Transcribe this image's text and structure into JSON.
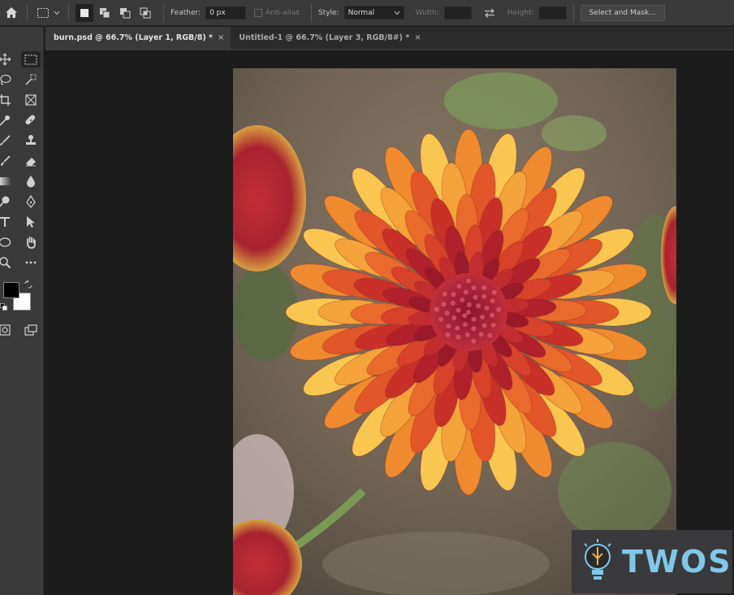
{
  "options_bar": {
    "feather_label": "Feather:",
    "feather_value": "0 px",
    "antialias_label": "Anti-alias",
    "style_label": "Style:",
    "style_value": "Normal",
    "width_label": "Width:",
    "width_value": "",
    "height_label": "Height:",
    "height_value": "",
    "select_mask_label": "Select and Mask..."
  },
  "tabs": [
    {
      "label": "burn.psd @ 66.7% (Layer 1, RGB/8) *",
      "close": "×",
      "active": true
    },
    {
      "label": "Untitled-1 @ 66.7% (Layer 3, RGB/8#) *",
      "close": "×",
      "active": false
    }
  ],
  "toolbar": {
    "tools": [
      "move-tool",
      "rectangular-marquee-tool",
      "lasso-tool",
      "object-selection-tool",
      "crop-tool",
      "frame-tool",
      "eyedropper-tool",
      "healing-brush-tool",
      "brush-tool",
      "clone-stamp-tool",
      "history-brush-tool",
      "eraser-tool",
      "gradient-tool",
      "blur-tool",
      "dodge-tool",
      "pen-tool",
      "type-tool",
      "path-selection-tool",
      "rectangle-tool",
      "hand-tool",
      "zoom-tool",
      "more-tools"
    ],
    "foreground_color": "#000000",
    "background_color": "#ffffff"
  },
  "document": {
    "content": "photo-of-orange-chrysanthemum"
  },
  "watermark": {
    "text": "TWOS",
    "color": "#7ec8e8"
  }
}
